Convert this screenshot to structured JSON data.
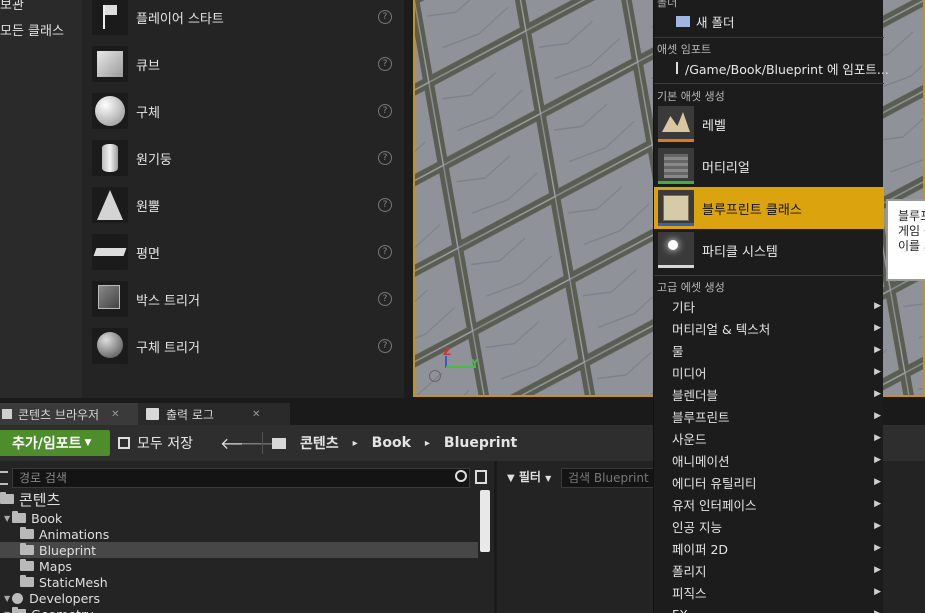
{
  "categories": {
    "items": [
      "보관",
      "모든 클래스"
    ]
  },
  "placement": {
    "items": [
      {
        "label": "플레이어 스타트",
        "icon": "player-start-icon"
      },
      {
        "label": "큐브",
        "icon": "cube-icon"
      },
      {
        "label": "구체",
        "icon": "sphere-icon"
      },
      {
        "label": "원기둥",
        "icon": "cylinder-icon"
      },
      {
        "label": "원뿔",
        "icon": "cone-icon"
      },
      {
        "label": "평면",
        "icon": "plane-icon"
      },
      {
        "label": "박스 트리거",
        "icon": "box-trigger-icon"
      },
      {
        "label": "구체 트리거",
        "icon": "sphere-trigger-icon"
      }
    ],
    "help_glyph": "?"
  },
  "viewport": {
    "axis_z": "Z",
    "axis_y": "Y"
  },
  "tabs": {
    "content_browser": "콘텐츠 브라우저",
    "output_log": "출력 로그",
    "close_glyph": "✕"
  },
  "toolbar": {
    "add_import": "추가/임포트",
    "save_all": "모두 저장",
    "back": "🡐",
    "forward": "🡒",
    "breadcrumb": [
      "콘텐츠",
      "Book",
      "Blueprint"
    ],
    "crumb_sep": "▸"
  },
  "tree": {
    "search_placeholder": "경로 검색",
    "rows": [
      {
        "label": "콘텐츠",
        "indent": 0,
        "big": true
      },
      {
        "label": "Book",
        "indent": 1
      },
      {
        "label": "Animations",
        "indent": 2
      },
      {
        "label": "Blueprint",
        "indent": 2,
        "selected": true
      },
      {
        "label": "Maps",
        "indent": 2
      },
      {
        "label": "StaticMesh",
        "indent": 2
      },
      {
        "label": "Developers",
        "indent": 1
      },
      {
        "label": "Geometry",
        "indent": 1
      }
    ]
  },
  "assets": {
    "filter_label": "필터",
    "search_placeholder": "검색 Blueprint"
  },
  "menu": {
    "folder_head": "폴더",
    "new_folder": "새 폴더",
    "import_head": "애셋 임포트",
    "import_item": "/Game/Book/Blueprint 에 임포트...",
    "basic_head": "기본 애셋 생성",
    "basic_items": [
      {
        "label": "레벨",
        "icon": "level-icon",
        "accent": "#e07a14"
      },
      {
        "label": "머티리얼",
        "icon": "material-icon",
        "accent": "#3bb33b"
      },
      {
        "label": "블루프린트 클래스",
        "icon": "blueprint-class-icon",
        "accent": "#2f62b8",
        "highlighted": true
      },
      {
        "label": "파티클 시스템",
        "icon": "particle-system-icon",
        "accent": "#d8d8d8"
      }
    ],
    "advanced_head": "고급 에셋 생성",
    "advanced_items": [
      "기타",
      "머티리얼 & 텍스처",
      "물",
      "미디어",
      "블렌더블",
      "블루프린트",
      "사운드",
      "애니메이션",
      "에디터 유틸리티",
      "유저 인터페이스",
      "인공 지능",
      "페이퍼 2D",
      "폴리지",
      "피직스",
      "FX"
    ],
    "submenu_glyph": "▶"
  },
  "tooltip": {
    "lines": [
      "블루프",
      "게임 플",
      "이를 사"
    ]
  },
  "colors": {
    "highlight": "#dba40e",
    "add_button": "#4e8d2c",
    "viewport_border": "#c8911a"
  }
}
